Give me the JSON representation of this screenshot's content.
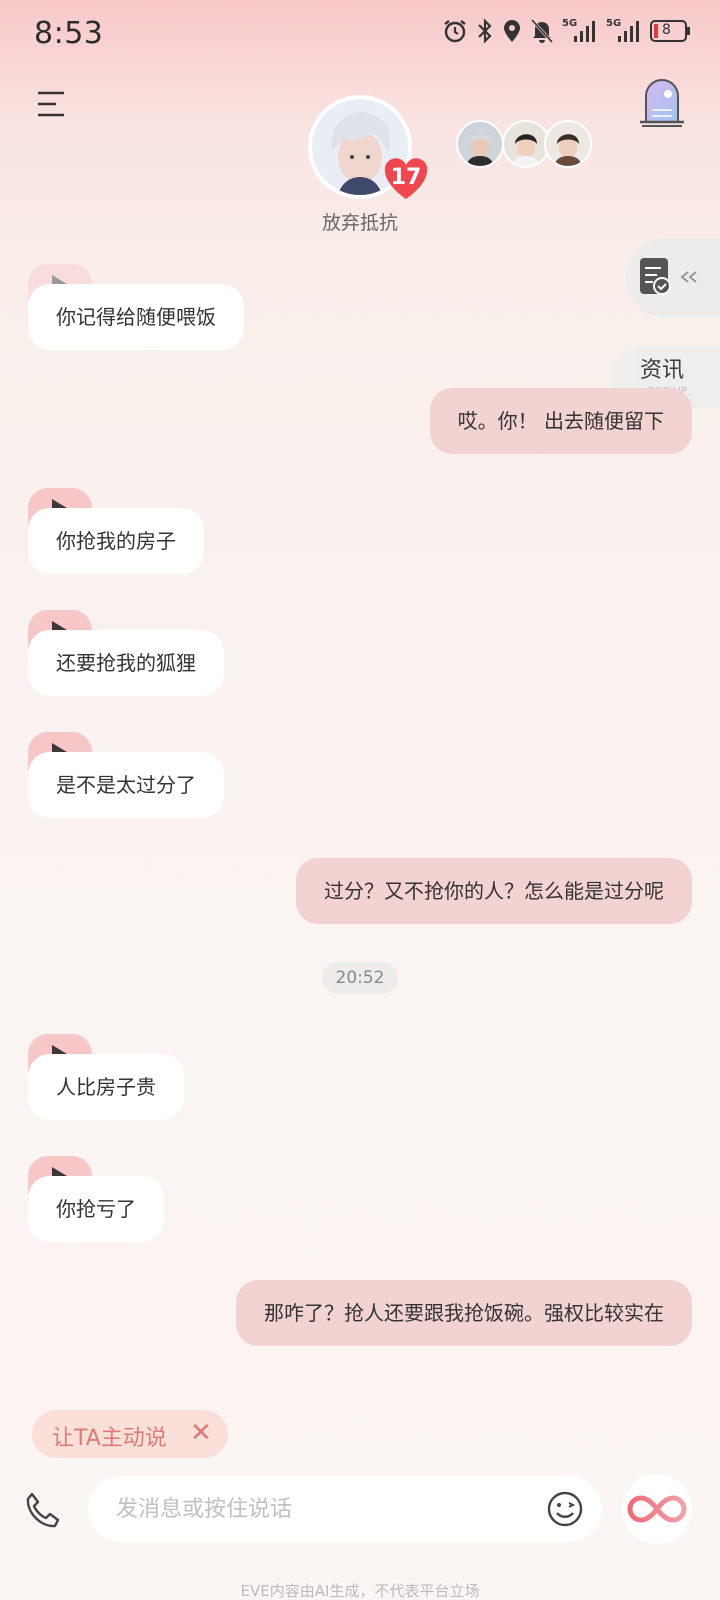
{
  "status_bar": {
    "time": "8:53",
    "signal_1": "5G",
    "signal_2": "5G",
    "battery": "8"
  },
  "header": {
    "character_name": "放弃抵抗",
    "affinity_level": "17",
    "menu_icon": "menu-icon",
    "store_icon": "castle-door-icon"
  },
  "floating": {
    "news_label": "资讯",
    "news_sub": "POP-UP"
  },
  "messages": [
    {
      "side": "left",
      "text": "你记得给随便喂饭"
    },
    {
      "side": "right",
      "text": "哎。你！ 出去随便留下"
    },
    {
      "side": "left",
      "text": "你抢我的房子"
    },
    {
      "side": "left",
      "text": "还要抢我的狐狸"
    },
    {
      "side": "left",
      "text": "是不是太过分了"
    },
    {
      "side": "right",
      "text": "过分？又不抢你的人？怎么能是过分呢"
    },
    {
      "side": "left",
      "text": "人比房子贵"
    },
    {
      "side": "left",
      "text": "你抢亏了"
    },
    {
      "side": "right",
      "text": "那咋了？抢人还要跟我抢饭碗。强权比较实在"
    }
  ],
  "timestamp": "20:52",
  "bottom": {
    "auto_chip_label": "让TA主动说",
    "auto_chip_close": "✕",
    "input_placeholder": "发消息或按住说话",
    "footer_note": "EVE内容由AI生成，不代表平台立场"
  },
  "colors": {
    "accent_pink": "#f6c7c6",
    "bubble_right": "#f2d3d1",
    "heart_red": "#f0464e",
    "chip_text": "#e27a74"
  }
}
